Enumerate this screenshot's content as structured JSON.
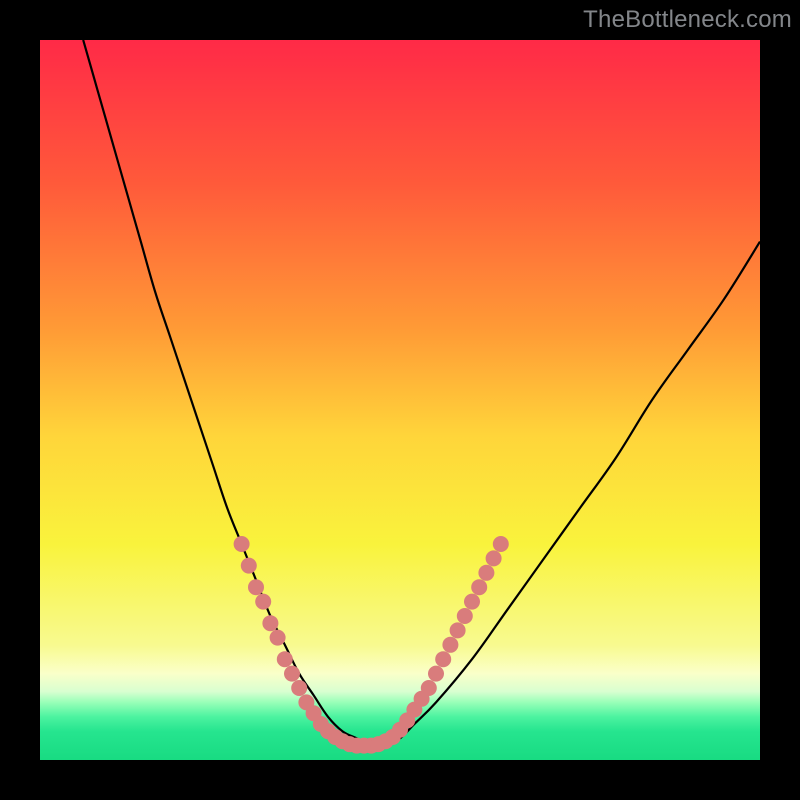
{
  "watermark": "TheBottleneck.com",
  "colors": {
    "black": "#000000",
    "curve": "#000000",
    "dot": "#d97c7c",
    "watermark": "#83868a"
  },
  "chart_data": {
    "type": "line",
    "title": "",
    "xlabel": "",
    "ylabel": "",
    "xlim": [
      0,
      100
    ],
    "ylim": [
      0,
      100
    ],
    "gradient_stops": [
      {
        "offset": 0.0,
        "color": "#ff2a47"
      },
      {
        "offset": 0.2,
        "color": "#ff5a3a"
      },
      {
        "offset": 0.4,
        "color": "#ff9a36"
      },
      {
        "offset": 0.55,
        "color": "#ffd53a"
      },
      {
        "offset": 0.7,
        "color": "#f9f33c"
      },
      {
        "offset": 0.84,
        "color": "#f8fa8f"
      },
      {
        "offset": 0.88,
        "color": "#faffc9"
      },
      {
        "offset": 0.905,
        "color": "#d8ffd0"
      },
      {
        "offset": 0.92,
        "color": "#98ffb8"
      },
      {
        "offset": 0.94,
        "color": "#4cf3a0"
      },
      {
        "offset": 0.96,
        "color": "#26e58f"
      },
      {
        "offset": 1.0,
        "color": "#18db82"
      }
    ],
    "series": [
      {
        "name": "bottleneck-curve",
        "x": [
          6,
          8,
          10,
          12,
          14,
          16,
          18,
          20,
          22,
          24,
          26,
          28,
          30,
          32,
          34,
          36,
          38,
          40,
          42,
          44,
          46,
          48,
          50,
          52,
          55,
          60,
          65,
          70,
          75,
          80,
          85,
          90,
          95,
          100
        ],
        "y": [
          100,
          93,
          86,
          79,
          72,
          65,
          59,
          53,
          47,
          41,
          35,
          30,
          25,
          20,
          16,
          12,
          9,
          6,
          4,
          3,
          2,
          2,
          3,
          5,
          8,
          14,
          21,
          28,
          35,
          42,
          50,
          57,
          64,
          72
        ]
      }
    ],
    "dots": {
      "name": "highlight-dots",
      "points": [
        {
          "x": 28,
          "y": 30
        },
        {
          "x": 29,
          "y": 27
        },
        {
          "x": 30,
          "y": 24
        },
        {
          "x": 31,
          "y": 22
        },
        {
          "x": 32,
          "y": 19
        },
        {
          "x": 33,
          "y": 17
        },
        {
          "x": 34,
          "y": 14
        },
        {
          "x": 35,
          "y": 12
        },
        {
          "x": 36,
          "y": 10
        },
        {
          "x": 37,
          "y": 8
        },
        {
          "x": 38,
          "y": 6.5
        },
        {
          "x": 39,
          "y": 5
        },
        {
          "x": 40,
          "y": 4
        },
        {
          "x": 41,
          "y": 3.2
        },
        {
          "x": 42,
          "y": 2.6
        },
        {
          "x": 43,
          "y": 2.2
        },
        {
          "x": 44,
          "y": 2
        },
        {
          "x": 45,
          "y": 2
        },
        {
          "x": 46,
          "y": 2
        },
        {
          "x": 47,
          "y": 2.2
        },
        {
          "x": 48,
          "y": 2.6
        },
        {
          "x": 49,
          "y": 3.2
        },
        {
          "x": 50,
          "y": 4.2
        },
        {
          "x": 51,
          "y": 5.5
        },
        {
          "x": 52,
          "y": 7
        },
        {
          "x": 53,
          "y": 8.5
        },
        {
          "x": 54,
          "y": 10
        },
        {
          "x": 55,
          "y": 12
        },
        {
          "x": 56,
          "y": 14
        },
        {
          "x": 57,
          "y": 16
        },
        {
          "x": 58,
          "y": 18
        },
        {
          "x": 59,
          "y": 20
        },
        {
          "x": 60,
          "y": 22
        },
        {
          "x": 61,
          "y": 24
        },
        {
          "x": 62,
          "y": 26
        },
        {
          "x": 63,
          "y": 28
        },
        {
          "x": 64,
          "y": 30
        }
      ]
    }
  }
}
